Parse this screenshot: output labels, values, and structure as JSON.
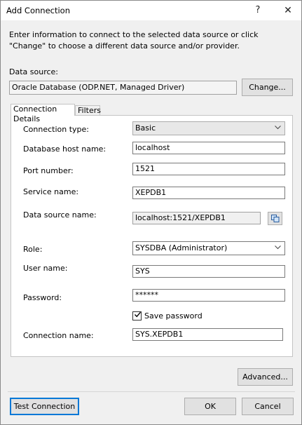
{
  "window": {
    "title": "Add Connection",
    "help_glyph": "?",
    "close_glyph": "✕"
  },
  "intro_text": "Enter information to connect to the selected data source or click \"Change\" to choose a different data source and/or provider.",
  "data_source": {
    "label": "Data source:",
    "value": "Oracle Database (ODP.NET, Managed Driver)",
    "change_button": "Change..."
  },
  "tabs": [
    {
      "label": "Connection Details",
      "active": true
    },
    {
      "label": "Filters",
      "active": false
    }
  ],
  "form": {
    "connection_type": {
      "label": "Connection type:",
      "value": "Basic"
    },
    "host": {
      "label": "Database host name:",
      "value": "localhost"
    },
    "port": {
      "label": "Port number:",
      "value": "1521"
    },
    "service": {
      "label": "Service name:",
      "value": "XEPDB1"
    },
    "dsn": {
      "label": "Data source name:",
      "value": "localhost:1521/XEPDB1"
    },
    "role": {
      "label": "Role:",
      "value": "SYSDBA (Administrator)"
    },
    "user": {
      "label": "User name:",
      "value": "SYS"
    },
    "password": {
      "label": "Password:",
      "value": "******"
    },
    "save_password": {
      "label": "Save password",
      "checked": true
    },
    "connection_name": {
      "label": "Connection name:",
      "value": "SYS.XEPDB1"
    }
  },
  "buttons": {
    "advanced": "Advanced...",
    "test": "Test Connection",
    "ok": "OK",
    "cancel": "Cancel"
  },
  "icons": {
    "chevron": "chevron-down-icon",
    "copy": "copy-icon",
    "check": "checkmark-icon"
  },
  "colors": {
    "focus_border": "#0078d7",
    "dialog_bg": "#f0f0f0"
  }
}
